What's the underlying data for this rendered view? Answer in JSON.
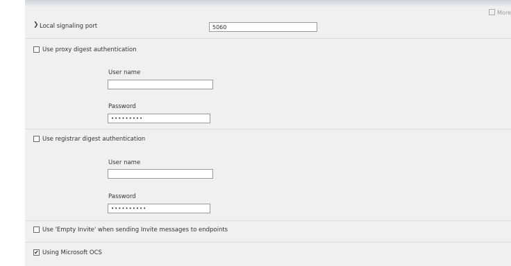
{
  "header": {
    "more_label": "More"
  },
  "port": {
    "label": "Local signaling port",
    "value": "5060"
  },
  "proxy_auth": {
    "label": "Use proxy digest authentication",
    "checked": false,
    "username_label": "User name",
    "username_value": "",
    "password_label": "Password",
    "password_value": "•••••••••"
  },
  "registrar_auth": {
    "label": "Use registrar digest authentication",
    "checked": false,
    "username_label": "User name",
    "username_value": "",
    "password_label": "Password",
    "password_value": "••••••••••"
  },
  "empty_invite": {
    "label": "Use 'Empty Invite' when sending Invite messages to endpoints",
    "checked": false
  },
  "ocs": {
    "label": "Using Microsoft OCS",
    "checked": true,
    "check_glyph": "✔"
  }
}
